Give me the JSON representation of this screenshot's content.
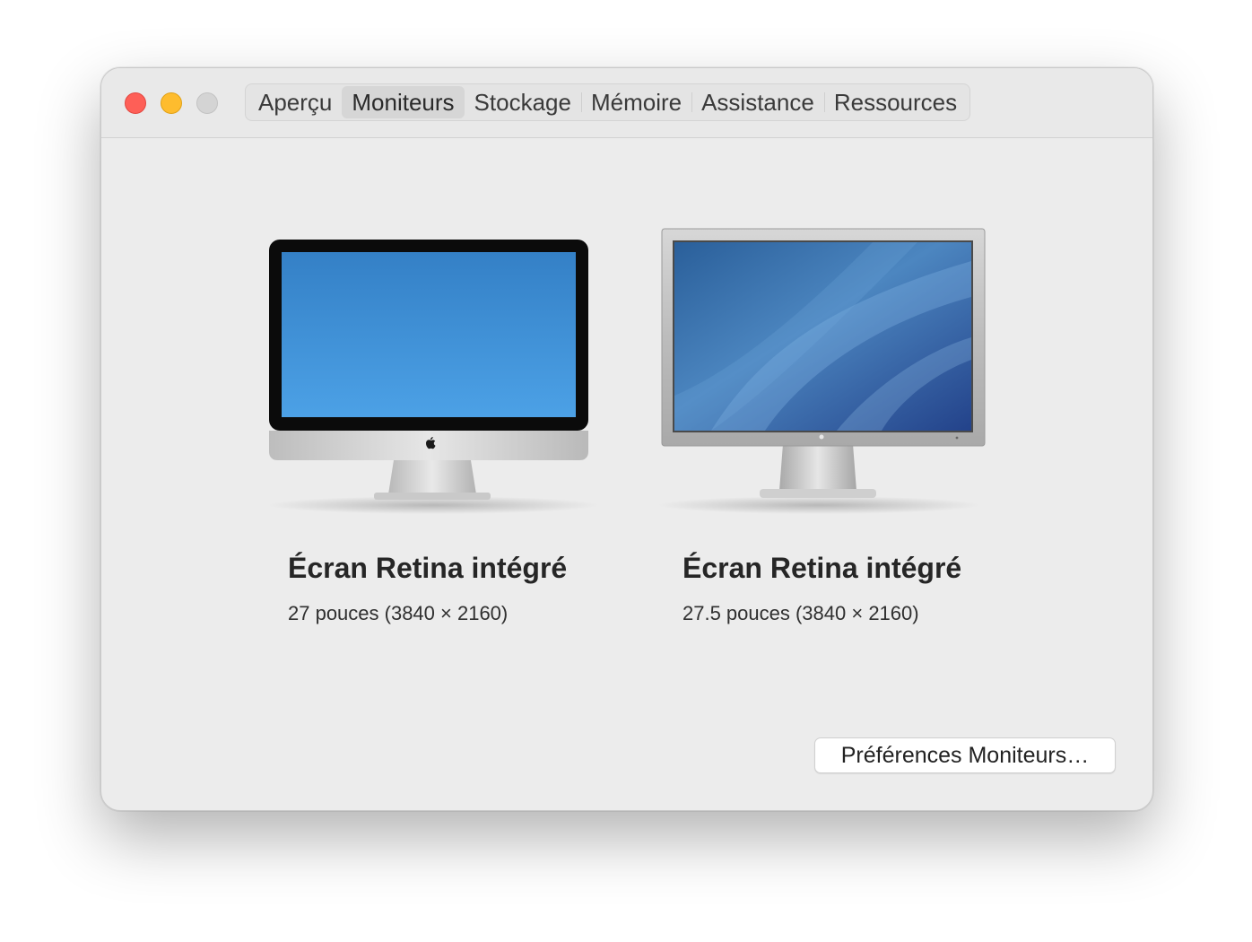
{
  "window": {
    "traffic_lights": [
      "close",
      "minimize",
      "zoom"
    ],
    "colors": {
      "close": "#fe5f57",
      "minimize": "#febc2e",
      "zoom": "#d4d4d4"
    }
  },
  "tabs": [
    {
      "label": "Aperçu",
      "selected": false
    },
    {
      "label": "Moniteurs",
      "selected": true
    },
    {
      "label": "Stockage",
      "selected": false
    },
    {
      "label": "Mémoire",
      "selected": false
    },
    {
      "label": "Assistance",
      "selected": false
    },
    {
      "label": "Ressources",
      "selected": false
    }
  ],
  "displays": [
    {
      "name": "Écran Retina intégré",
      "spec": "27 pouces (3840 × 2160)",
      "icon": "imac-icon"
    },
    {
      "name": "Écran Retina intégré",
      "spec": "27.5 pouces (3840 × 2160)",
      "icon": "cinema-display-icon"
    }
  ],
  "actions": {
    "display_prefs_label": "Préférences Moniteurs…"
  }
}
